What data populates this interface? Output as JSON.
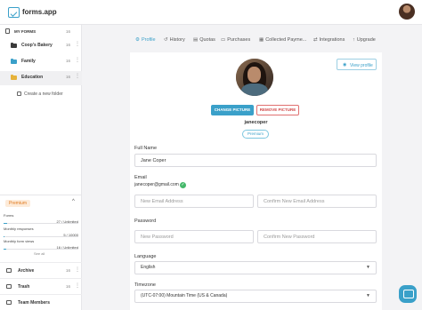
{
  "app": {
    "brand": "forms.app"
  },
  "sidebar": {
    "my_forms_label": "MY FORMS",
    "my_forms_count": "16",
    "folders": [
      {
        "label": "Coop's Bakery",
        "count": "16",
        "color": "#3a3a3a"
      },
      {
        "label": "Family",
        "count": "16",
        "color": "#3aa0c9"
      },
      {
        "label": "Education",
        "count": "16",
        "color": "#e6b23a"
      }
    ],
    "new_folder_label": "Create a new folder",
    "premium_label": "Premium",
    "usage": [
      {
        "name": "Forms",
        "value": "27 / Unlimited",
        "fraction": 0.05
      },
      {
        "name": "Monthly responses",
        "value": "5 / 10000",
        "fraction": 0.01
      },
      {
        "name": "Monthly form views",
        "value": "16 / Unlimited",
        "fraction": 0.03
      }
    ],
    "see_all_label": "See all",
    "bottom_items": [
      {
        "label": "Archive",
        "count": "16"
      },
      {
        "label": "Trash",
        "count": "16"
      },
      {
        "label": "Team Members",
        "count": ""
      }
    ]
  },
  "tabs": [
    {
      "label": "Profile",
      "icon": "gear-icon",
      "active": true
    },
    {
      "label": "History",
      "icon": "history-icon",
      "active": false
    },
    {
      "label": "Quotas",
      "icon": "quotas-icon",
      "active": false
    },
    {
      "label": "Purchases",
      "icon": "card-icon",
      "active": false
    },
    {
      "label": "Collected Payme...",
      "icon": "payment-icon",
      "active": false
    },
    {
      "label": "Integrations",
      "icon": "integrations-icon",
      "active": false
    },
    {
      "label": "Upgrade",
      "icon": "upgrade-icon",
      "active": false
    }
  ],
  "profile": {
    "view_profile_label": "View profile",
    "change_picture_label": "CHANGE PICTURE",
    "remove_picture_label": "REMOVE PICTURE",
    "username": "janecoper",
    "plan_badge": "Premium",
    "full_name_label": "Full Name",
    "full_name_value": "Jane Coper",
    "email_label": "Email",
    "email_value": "janecoper@gmail.com",
    "new_email_placeholder": "New Email Address",
    "confirm_email_placeholder": "Confirm New Email Address",
    "password_label": "Password",
    "new_password_placeholder": "New Password",
    "confirm_password_placeholder": "Confirm New Password",
    "language_label": "Language",
    "language_value": "English",
    "timezone_label": "Timezone",
    "timezone_value": "(UTC-07:00) Mountain Time (US & Canada)"
  },
  "colors": {
    "accent": "#3aa0c9",
    "danger": "#d24a4a",
    "premium": "#e07a1f",
    "verified": "#44b86a"
  }
}
